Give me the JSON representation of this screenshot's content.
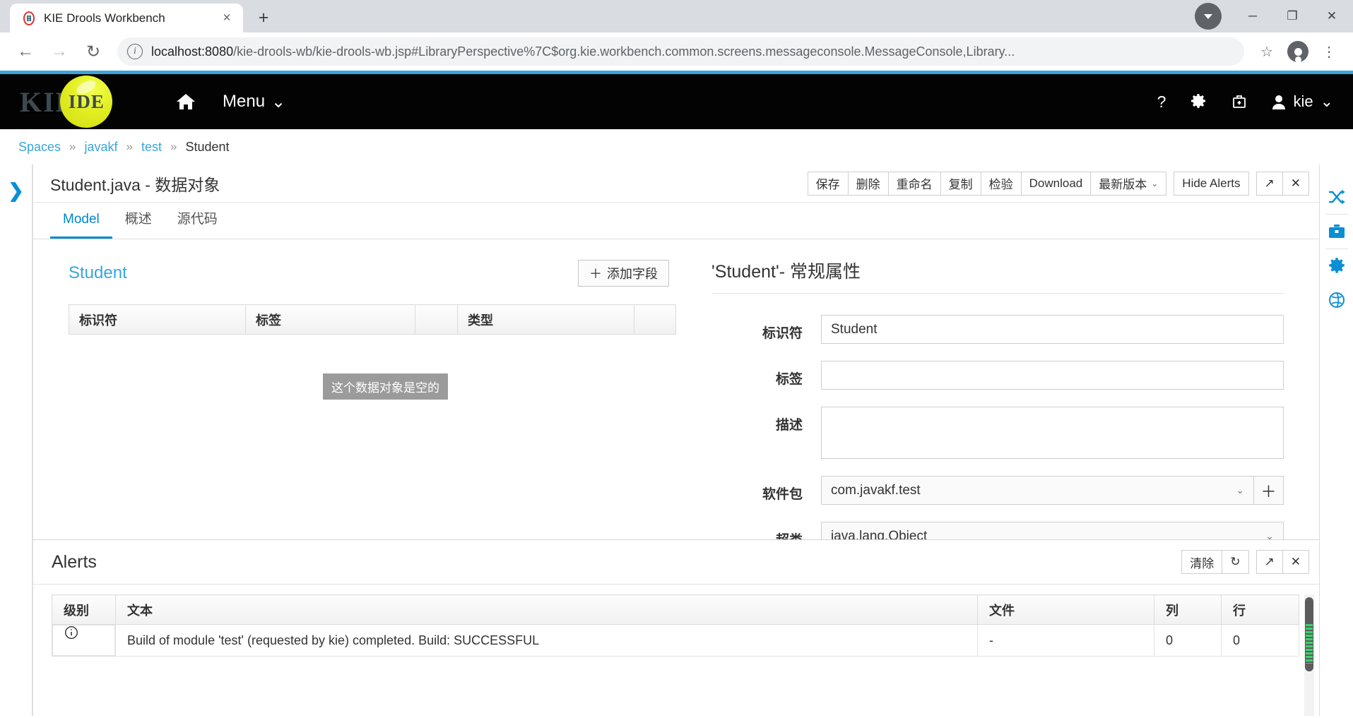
{
  "browser": {
    "tab_title": "KIE Drools Workbench",
    "new_tab_label": "+",
    "close_tab_label": "×",
    "url_host": "localhost:8080",
    "url_rest": "/kie-drools-wb/kie-drools-wb.jsp#LibraryPerspective%7C$org.kie.workbench.common.screens.messageconsole.MessageConsole,Library...",
    "minimize_label": "─",
    "maximize_label": "❐",
    "close_label": "✕",
    "back_label": "←",
    "forward_label": "→",
    "reload_label": "↻",
    "bookmark_label": "☆",
    "info_label": "i"
  },
  "app_header": {
    "brand_kie": "KIE",
    "brand_ide": "IDE",
    "menu_label": "Menu",
    "menu_caret": "⌄",
    "help_label": "?",
    "user_label": "kie",
    "user_caret": "⌄",
    "accent_color": "#39a5dc"
  },
  "breadcrumb": {
    "items": [
      "Spaces",
      "javakf",
      "test",
      "Student"
    ],
    "separator": "»"
  },
  "editor": {
    "title": "Student.java - 数据对象",
    "toolbar": {
      "save": "保存",
      "delete": "删除",
      "rename": "重命名",
      "copy": "复制",
      "validate": "检验",
      "download": "Download",
      "version": "最新版本",
      "version_caret": "⌄",
      "hide_alerts": "Hide Alerts",
      "expand": "↗",
      "close": "✕"
    },
    "tabs": [
      {
        "label": "Model",
        "active": true
      },
      {
        "label": "概述",
        "active": false
      },
      {
        "label": "源代码",
        "active": false
      }
    ]
  },
  "data_model": {
    "object_name": "Student",
    "add_field_label": "添加字段",
    "add_field_icon": "＋",
    "columns": [
      "标识符",
      "标签",
      "",
      "类型",
      ""
    ],
    "rows": [],
    "empty_tooltip": "这个数据对象是空的"
  },
  "properties": {
    "title": "'Student'- 常规属性",
    "fields": [
      {
        "label": "标识符",
        "value": "Student",
        "type": "text"
      },
      {
        "label": "标签",
        "value": "",
        "type": "text"
      },
      {
        "label": "描述",
        "value": "",
        "type": "textarea"
      },
      {
        "label": "软件包",
        "value": "com.javakf.test",
        "type": "select-plus"
      },
      {
        "label": "超类",
        "value": "java.lang.Object",
        "type": "select"
      }
    ],
    "caret": "⌄",
    "plus": "＋"
  },
  "alerts": {
    "title": "Alerts",
    "buttons": {
      "clear": "清除",
      "refresh": "↻",
      "expand": "↗",
      "close": "✕"
    },
    "columns": [
      "级别",
      "文本",
      "文件",
      "列",
      "行"
    ],
    "rows": [
      {
        "level_icon": "info-icon",
        "text": "Build of module 'test' (requested by kie) completed. Build: SUCCESSFUL",
        "file": "-",
        "column": "0",
        "line": "0"
      }
    ]
  },
  "right_rail": {
    "items": [
      "shuffle-icon",
      "briefcase-icon",
      "gear-icon",
      "globe-icon"
    ],
    "color": "#0a8fd4"
  },
  "left_rail": {
    "chevron": "❯"
  }
}
